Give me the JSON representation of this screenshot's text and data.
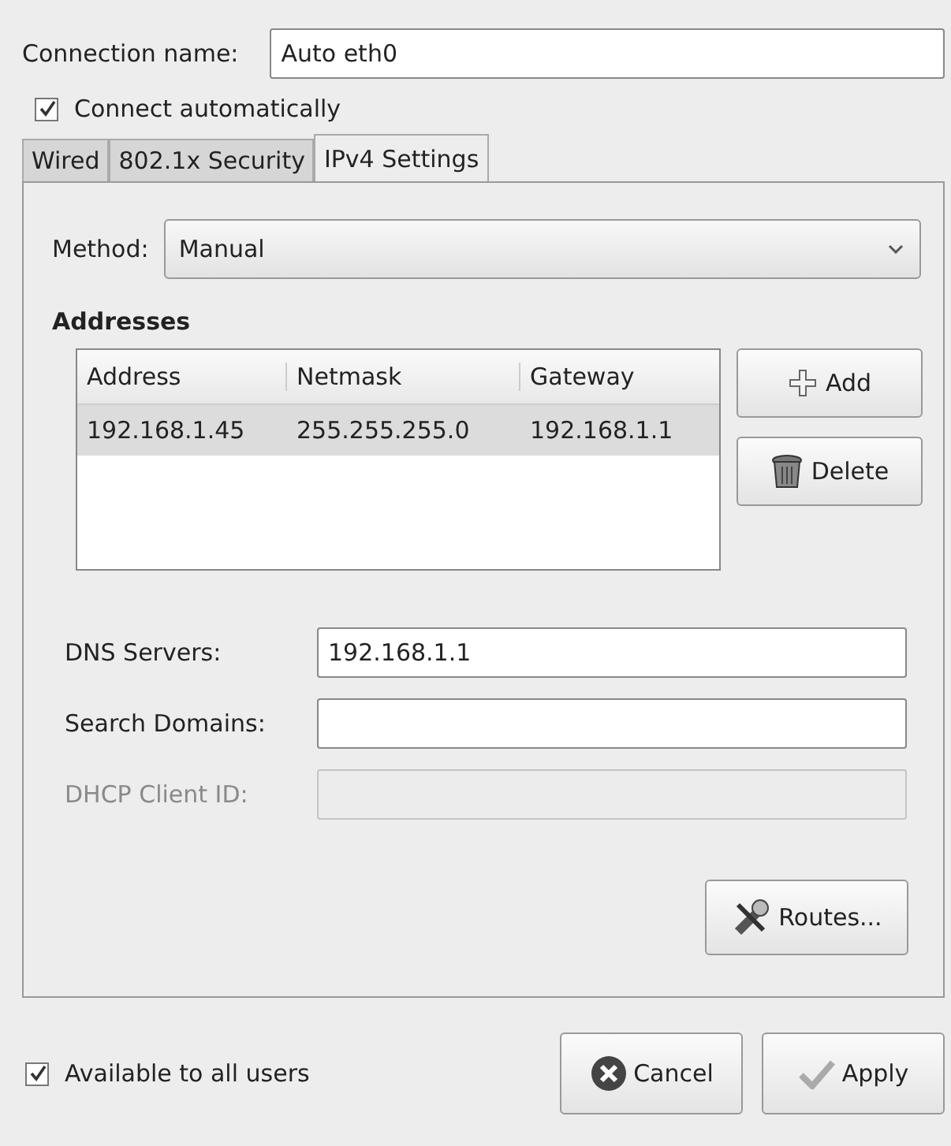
{
  "connection_name": {
    "label": "Connection name:",
    "value": "Auto eth0"
  },
  "connect_automatically": {
    "label": "Connect automatically",
    "checked": true
  },
  "tabs": [
    {
      "label": "Wired",
      "selected": false
    },
    {
      "label": "802.1x Security",
      "selected": false
    },
    {
      "label": "IPv4 Settings",
      "selected": true
    }
  ],
  "method": {
    "label": "Method:",
    "value": "Manual"
  },
  "addresses": {
    "title": "Addresses",
    "columns": [
      "Address",
      "Netmask",
      "Gateway"
    ],
    "rows": [
      {
        "cells": [
          "192.168.1.45",
          "255.255.255.0",
          "192.168.1.1"
        ],
        "selected": true
      }
    ],
    "buttons": [
      {
        "label": "Add",
        "kind": "add"
      },
      {
        "label": "Delete",
        "kind": "delete"
      }
    ]
  },
  "fields": [
    {
      "label": "DNS Servers:",
      "value": "192.168.1.1",
      "disabled": false
    },
    {
      "label": "Search Domains:",
      "disabled": false
    },
    {
      "label": "DHCP Client ID:",
      "disabled": true
    }
  ],
  "routes_button": "Routes...",
  "available_to_all_users": {
    "label": "Available to all users",
    "checked": true
  },
  "buttons": [
    {
      "label": "Cancel",
      "kind": "cancel"
    },
    {
      "label": "Apply",
      "kind": "apply"
    }
  ]
}
